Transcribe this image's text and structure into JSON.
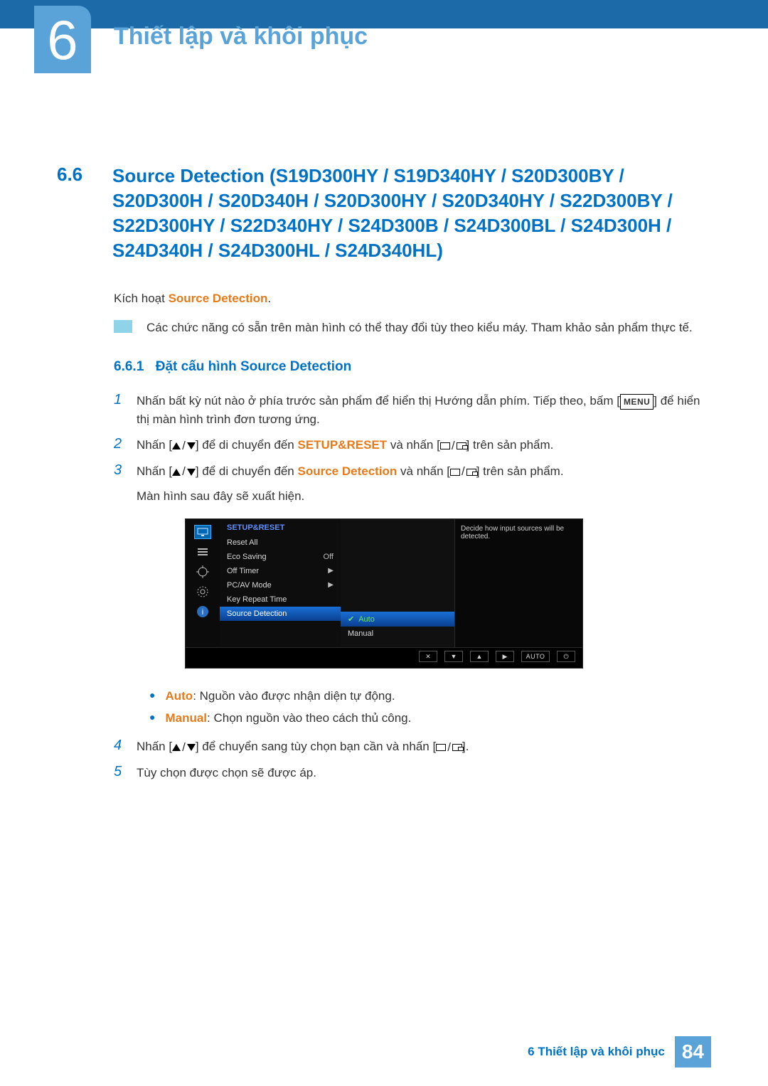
{
  "chapter": {
    "number": "6",
    "title": "Thiết lập và khôi phục"
  },
  "section": {
    "number": "6.6",
    "title": "Source Detection (S19D300HY / S19D340HY / S20D300BY / S20D300H / S20D340H / S20D300HY / S20D340HY / S22D300BY / S22D300HY / S22D340HY / S24D300B / S24D300BL / S24D300H / S24D340H / S24D300HL / S24D340HL)"
  },
  "intro": {
    "prefix": "Kích hoạt ",
    "term": "Source Detection",
    "suffix": "."
  },
  "note": "Các chức năng có sẵn trên màn hình có thể thay đổi tùy theo kiểu máy. Tham khảo sản phẩm thực tế.",
  "subsection": {
    "number": "6.6.1",
    "title": "Đặt cấu hình Source Detection"
  },
  "steps": {
    "s1a": "Nhấn bất kỳ nút nào ở phía trước sản phẩm để hiển thị Hướng dẫn phím. Tiếp theo, bấm [",
    "s1b": "] để hiển thị màn hình trình đơn tương ứng.",
    "s2a": "Nhấn [",
    "s2b": "] để di chuyển đến ",
    "s2term": "SETUP&RESET",
    "s2c": " và nhấn [",
    "s2d": "] trên sản phẩm.",
    "s3a": "Nhấn [",
    "s3b": "] để di chuyển đến ",
    "s3term": "Source Detection",
    "s3c": " và nhấn [",
    "s3d": "] trên sản phẩm.",
    "s3e": "Màn hình sau đây sẽ xuất hiện.",
    "s4a": "Nhấn [",
    "s4b": "] để chuyển sang tùy chọn bạn cần và nhấn [",
    "s4c": "].",
    "s5": "Tùy chọn được chọn sẽ được áp."
  },
  "menu_label": "MENU",
  "osd": {
    "header": "SETUP&RESET",
    "items": {
      "reset": "Reset All",
      "eco": "Eco Saving",
      "eco_val": "Off",
      "off_timer": "Off Timer",
      "pcav": "PC/AV Mode",
      "key_repeat": "Key Repeat Time",
      "source": "Source Detection"
    },
    "options": {
      "auto": "Auto",
      "manual": "Manual"
    },
    "desc": "Decide how input sources will be detected.",
    "bottom_auto": "AUTO"
  },
  "bullets": {
    "auto_term": "Auto",
    "auto_text": ": Nguồn vào được nhận diện tự động.",
    "manual_term": "Manual",
    "manual_text": ": Chọn nguồn vào theo cách thủ công."
  },
  "footer": {
    "label": "6 Thiết lập và khôi phục",
    "page": "84"
  }
}
